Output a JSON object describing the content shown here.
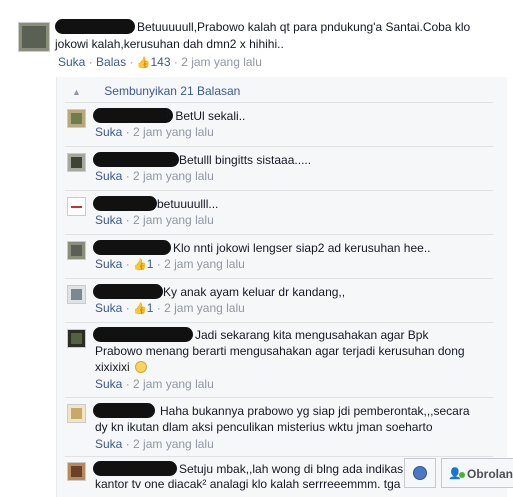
{
  "main_comment": {
    "line1": "Betuuuuull,Prabowo kalah qt para pndukung'a Santai.Coba klo",
    "line2": "jokowi kalah,kerusuhan dah dmn2 x hihihi..",
    "like_label": "Suka",
    "reply_label": "Balas",
    "likes": "143",
    "time": "2 jam yang lalu"
  },
  "hide_replies": "Sembunyikan 21 Balasan",
  "replies": [
    {
      "text": "c BetUl sekali..",
      "like_label": "Suka",
      "likes": "",
      "time": "2 jam yang lalu"
    },
    {
      "text": "Betulll bingitts sistaaa.....",
      "like_label": "Suka",
      "likes": "",
      "time": "2 jam yang lalu"
    },
    {
      "text": "betuuuulll...",
      "like_label": "Suka",
      "likes": "",
      "time": "2 jam yang lalu"
    },
    {
      "text": "Klo nnti jokowi lengser siap2 ad kerusuhan hee..",
      "like_label": "Suka",
      "likes": "1",
      "time": "2 jam yang lalu"
    },
    {
      "text": "Ky anak ayam keluar dr kandang,,",
      "like_label": "Suka",
      "likes": "1",
      "time": "2 jam yang lalu"
    },
    {
      "text": "Jadi sekarang kita mengusahakan agar Bpk",
      "text2": "Prabowo menang berarti mengusahakan agar terjadi kerusuhan dong",
      "text3": "xixixixi",
      "like_label": "Suka",
      "likes": "",
      "time": "2 jam yang lalu"
    },
    {
      "text": "Haha bukannya prabowo yg siap jdi pemberontak,,,secara",
      "text2": "dy kn ikutan dlam aksi penculikan misterius wktu jman soeharto",
      "like_label": "Suka",
      "likes": "",
      "time": "2 jam yang lalu"
    },
    {
      "text": "Setuju mbak,,lah wong di blng ada indikas",
      "text2": "kantor tv one diacak² analagi klo kalah serrreeemmm. tga"
    }
  ],
  "chat": {
    "label": "Obrolan"
  },
  "colors": {
    "link": "#3b5998",
    "meta": "#9197a3",
    "panel": "#f6f7f8"
  }
}
